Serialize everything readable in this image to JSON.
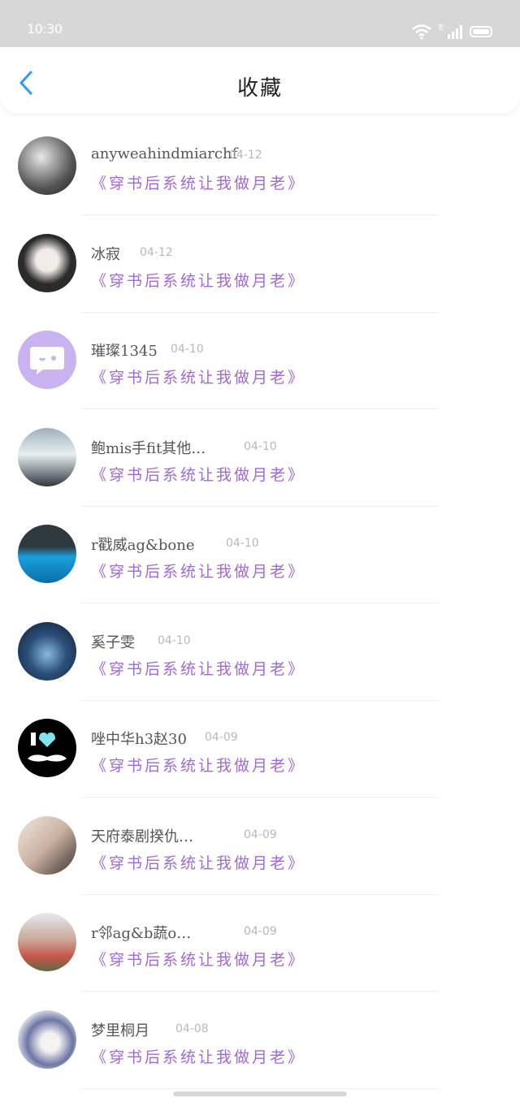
{
  "status": {
    "time": "10:30",
    "network": "E"
  },
  "header": {
    "title": "收藏"
  },
  "items": [
    {
      "name": "anyweahindmiarchf",
      "date": "04-12",
      "book": "《穿书后系统让我做月老》",
      "avatar_color": "#444444"
    },
    {
      "name": "冰寂",
      "date": "04-12",
      "book": "《穿书后系统让我做月老》",
      "avatar_color": "#2a2a2a"
    },
    {
      "name": "璀璨1345",
      "date": "04-10",
      "book": "《穿书后系统让我做月老》",
      "avatar_color": "#c9b3f1"
    },
    {
      "name": "鲍mis手fit其他…",
      "date": "04-10",
      "book": "《穿书后系统让我做月老》",
      "avatar_color": "#6a7b86"
    },
    {
      "name": "r戳威ag&amp;bone",
      "date": "04-10",
      "book": "《穿书后系统让我做月老》",
      "avatar_color": "#1d82b6"
    },
    {
      "name": "奚子雯",
      "date": "04-10",
      "book": "《穿书后系统让我做月老》",
      "avatar_color": "#1e3552"
    },
    {
      "name": "唑中华h3赵30",
      "date": "04-09",
      "book": "《穿书后系统让我做月老》",
      "avatar_color": "#000000"
    },
    {
      "name": "天府泰剧揆仇…",
      "date": "04-09",
      "book": "《穿书后系统让我做月老》",
      "avatar_color": "#d7c1b4"
    },
    {
      "name": "r邻ag&amp;b蔬o…",
      "date": "04-09",
      "book": "《穿书后系统让我做月老》",
      "avatar_color": "#c96b5e"
    },
    {
      "name": "梦里桐月",
      "date": "04-08",
      "book": "《穿书后系统让我做月老》",
      "avatar_color": "#6f79a8"
    }
  ]
}
